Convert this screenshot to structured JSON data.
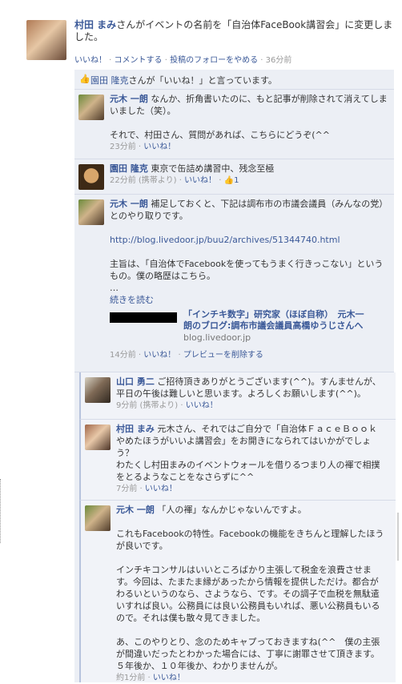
{
  "post": {
    "author": "村田 まみ",
    "text": "さんがイベントの名前を「自治体FaceBook講習会」に変更しました。",
    "actions": {
      "like": "いいね！",
      "comment": "コメントする",
      "unfollow": "投稿のフォローをやめる",
      "time": "36分前"
    }
  },
  "likes": {
    "name": "園田 隆克",
    "text": "さんが「いいね！」と言っています。"
  },
  "comments": [
    {
      "author": "元木 一朗",
      "lines": [
        "なんか、折角書いたのに、もと記事が削除されて消えてしまいました（笑）。",
        "",
        "それで、村田さん、質問があれば、こちらにどうぞ(^^"
      ],
      "time": "23分前",
      "like": "いいね！"
    },
    {
      "author": "園田 隆克",
      "lines": [
        "東京で缶詰め講習中、残念至極"
      ],
      "time": "22分前 (携帯より)",
      "like": "いいね！",
      "like_count": "1"
    },
    {
      "author": "元木 一朗",
      "lines": [
        "補足しておくと、下記は調布市の市議会議員（みんなの党）とのやり取りです。"
      ],
      "url": "http://blog.livedoor.jp/buu2/archives/51344740.html",
      "lines2": [
        "主旨は、「自治体でFacebookを使ってもうまく行きっこない」というもの。僕の略歴はこちら。",
        "…"
      ],
      "read_more": "続きを読む",
      "preview_title": "「インチキ数字」研究家（ほぼ自称）　元木一朗のブログ:調布市議会議員高橋ゆうじさんへ",
      "preview_domain": "blog.livedoor.jp",
      "time": "14分前",
      "like": "いいね！",
      "remove_preview": "プレビューを削除する"
    },
    {
      "author": "山口 勇二",
      "lines": [
        "ご招待頂きありがとうございます(^^)。すんませんが、平日の午後は難しいと思います。よろしくお願いします(^^)。"
      ],
      "time": "9分前 (携帯より)",
      "like": "いいね！"
    },
    {
      "author": "村田 まみ",
      "lines": [
        "元木さん、それではご自分で「自治体ＦａｃｅＢｏｏｋやめたほうがいいよ講習会」をお開きになられてはいかがでしょう？",
        "わたくし村田まみのイベントウォールを借りるつまり人の褌で相撲をとるようなことをなさらずに^^"
      ],
      "time": "7分前",
      "like": "いいね！"
    },
    {
      "author": "元木 一朗",
      "lines": [
        "「人の褌」なんかじゃないんですよ。",
        "",
        "これもFacebookの特性。Facebookの機能をきちんと理解したほうが良いです。",
        "",
        "インチキコンサルはいいところばかり主張して税金を浪費させます。今回は、たまたま縁があったから情報を提供しただけ。都合がわるいというのなら、さようなら、です。その調子で血税を無駄遣いすれば良い。公務員には良い公務員もいれば、悪い公務員もいるので。それは僕も散々見てきました。",
        "",
        "あ、このやりとり、念のためキャプっておきますね(^^　僕の主張が間違いだったとわかった場合には、丁寧に謝罪させて頂きます。５年後か、１０年後か、わかりませんが。"
      ],
      "time": "約1分前",
      "like": "いいね！"
    }
  ]
}
